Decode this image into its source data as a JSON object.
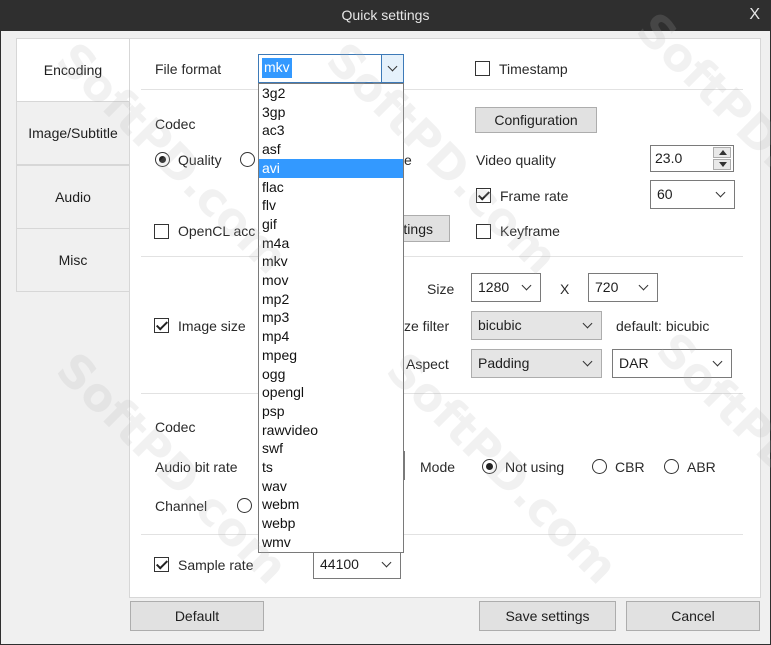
{
  "window": {
    "title": "Quick settings",
    "close_glyph": "X"
  },
  "tabs": [
    {
      "label": "Encoding",
      "active": true
    },
    {
      "label": "Image/Subtitle",
      "active": false
    },
    {
      "label": "Audio",
      "active": false
    },
    {
      "label": "Misc",
      "active": false
    }
  ],
  "format": {
    "label": "File format",
    "value": "mkv",
    "timestamp_label": "Timestamp",
    "timestamp_checked": false,
    "options": [
      "3g2",
      "3gp",
      "ac3",
      "asf",
      "avi",
      "flac",
      "flv",
      "gif",
      "m4a",
      "mkv",
      "mov",
      "mp2",
      "mp3",
      "mp4",
      "mpeg",
      "ogg",
      "opengl",
      "psp",
      "rawvideo",
      "swf",
      "ts",
      "wav",
      "webm",
      "webp",
      "wmv"
    ],
    "highlighted": "avi"
  },
  "video": {
    "codec_label": "Codec",
    "configuration_button": "Configuration",
    "quality_radio": "Quality",
    "quality_checked": true,
    "partial_e": "e",
    "video_quality_label": "Video quality",
    "video_quality_value": "23.0",
    "frame_rate_label": "Frame rate",
    "frame_rate_checked": true,
    "frame_rate_value": "60",
    "opencl_label": "OpenCL acc",
    "opencl_checked": false,
    "settings_button_partial": "tings",
    "keyframe_label": "Keyframe",
    "keyframe_checked": false
  },
  "image": {
    "size_label": "Size",
    "width": "1280",
    "x_sep": "X",
    "height": "720",
    "image_size_label": "Image size",
    "image_size_checked": true,
    "size_filter_label": "ze filter",
    "size_filter_value": "bicubic",
    "size_filter_default": "default: bicubic",
    "aspect_label": "Aspect",
    "aspect_value": "Padding",
    "aspect_mode": "DAR"
  },
  "audio": {
    "codec_label": "Codec",
    "bitrate_label": "Audio bit rate",
    "mode_label": "Mode",
    "mode_not_using": "Not using",
    "mode_cbr": "CBR",
    "mode_abr": "ABR",
    "mode_selected": "Not using",
    "channel_label": "Channel",
    "sample_rate_label": "Sample rate",
    "sample_rate_checked": true,
    "sample_rate_value": "44100"
  },
  "footer": {
    "default_button": "Default",
    "save_button": "Save settings",
    "cancel_button": "Cancel"
  },
  "watermark": "SoftPD.com"
}
